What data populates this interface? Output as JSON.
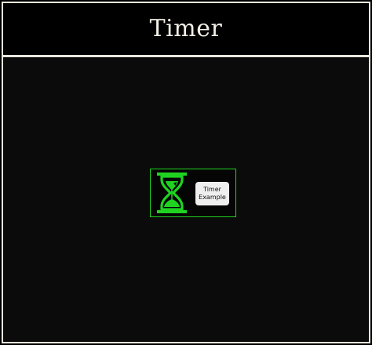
{
  "header": {
    "title": "Timer"
  },
  "timer_widget": {
    "icon": "hourglass-icon",
    "label_line1": "Timer",
    "label_line2": "Example"
  },
  "colors": {
    "background": "#000000",
    "content_background": "#0b0b0b",
    "border": "#e9e6dc",
    "accent_green": "#1fd321",
    "label_background": "#efefef"
  }
}
